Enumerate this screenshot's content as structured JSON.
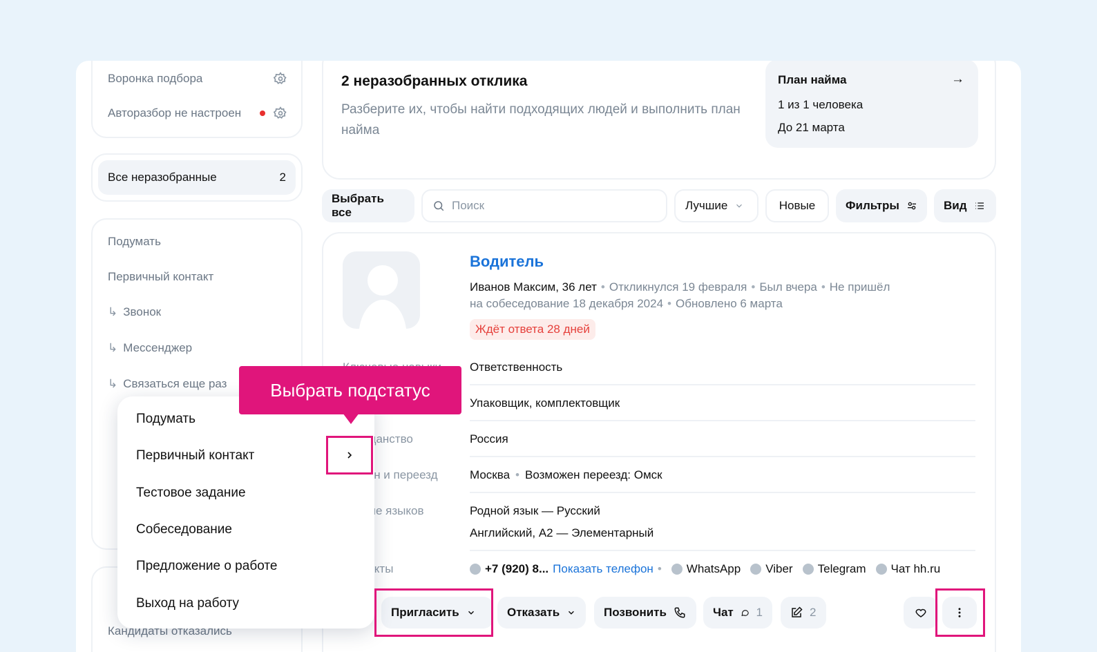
{
  "sidebar": {
    "funnel_label": "Воронка подбора",
    "autosort_label": "Автоcразбор не настроен",
    "all_unsorted_label": "Все неразобранные",
    "all_unsorted_count": "2",
    "items": [
      {
        "label": "Подумать"
      },
      {
        "label": "Первичный контакт"
      },
      {
        "label": "Звонок"
      },
      {
        "label": "Мессенджер"
      },
      {
        "label": "Связаться еще раз"
      }
    ],
    "bottom_item": "Кандидаты отказались"
  },
  "header": {
    "title": "2 неразобранных отклика",
    "subtitle": "Разберите их, чтобы найти подходящих людей и выполнить план найма",
    "plan": {
      "title": "План найма",
      "line1": "1 из 1 человека",
      "line2": "До 21 марта"
    }
  },
  "toolbar": {
    "select_all": "Выбрать все",
    "search_placeholder": "Поиск",
    "sort_label": "Лучшие",
    "new_label": "Новые",
    "filters_label": "Фильтры",
    "view_label": "Вид"
  },
  "candidate": {
    "vacancy": "Водитель",
    "name": "Иванов Максим, 36 лет",
    "responded": "Откликнулся 19 февраля",
    "seen": "Был вчера",
    "no_show": "Не пришёл",
    "no_show2": "на собеседование 18 декабря 2024",
    "updated": "Обновлено 6 марта",
    "badge": "Ждёт ответа 28 дней",
    "fields": [
      {
        "label": "Ключевые навыки",
        "value": "Ответственность"
      },
      {
        "label": "",
        "value": "Упаковщик, комплектовщик"
      },
      {
        "label": "Гражданство",
        "value": "Россия"
      },
      {
        "label": "Регион и переезд",
        "value": "Москва"
      },
      {
        "label": "Знание языков",
        "value": "Родной язык — Русский"
      }
    ],
    "relocation": "Возможен переезд: Омск",
    "language2": "Английский, A2 — Элементарный",
    "contacts_label": "Контакты",
    "phone": "+7 (920) 8...",
    "show_phone": "Показать телефон",
    "whatsapp": "WhatsApp",
    "viber": "Viber",
    "telegram": "Telegram",
    "hh_chat": "Чат hh.ru"
  },
  "actions": {
    "invite": "Пригласить",
    "reject": "Отказать",
    "call": "Позвонить",
    "chat": "Чат",
    "chat_count": "1",
    "notes_count": "2"
  },
  "menu": {
    "items": [
      {
        "label": "Подумать"
      },
      {
        "label": "Первичный контакт"
      },
      {
        "label": "Тестовое задание"
      },
      {
        "label": "Собеседование"
      },
      {
        "label": "Предложение о работе"
      },
      {
        "label": "Выход на работу"
      }
    ]
  },
  "tooltip": {
    "text": "Выбрать подстатус"
  },
  "colors": {
    "accent": "#e0157b",
    "link": "#1a73d9",
    "badge": "#e5403b"
  }
}
